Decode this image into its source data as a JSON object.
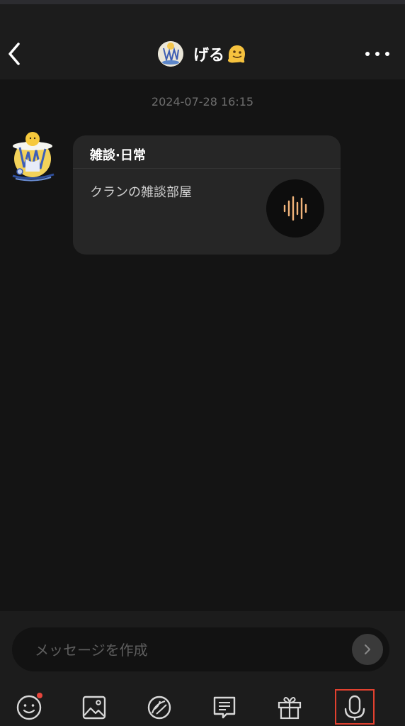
{
  "header": {
    "title": "げる",
    "back_icon": "chevron-left-icon",
    "more_icon": "more-horizontal-icon"
  },
  "chat": {
    "timestamp": "2024-07-28 16:15",
    "message": {
      "card_title": "雑談·日常",
      "card_description": "クランの雑談部屋",
      "voice_icon": "voice-waveform-icon",
      "accent_color": "#f0b37a"
    }
  },
  "composer": {
    "placeholder": "メッセージを作成",
    "send_icon": "chevron-right-icon"
  },
  "toolbar": {
    "items": [
      {
        "icon": "emoji-icon",
        "has_notification": true
      },
      {
        "icon": "image-icon"
      },
      {
        "icon": "sticker-icon"
      },
      {
        "icon": "message-list-icon"
      },
      {
        "icon": "gift-icon"
      },
      {
        "icon": "microphone-icon",
        "highlighted": true
      }
    ],
    "highlight_color": "#e2412f"
  }
}
